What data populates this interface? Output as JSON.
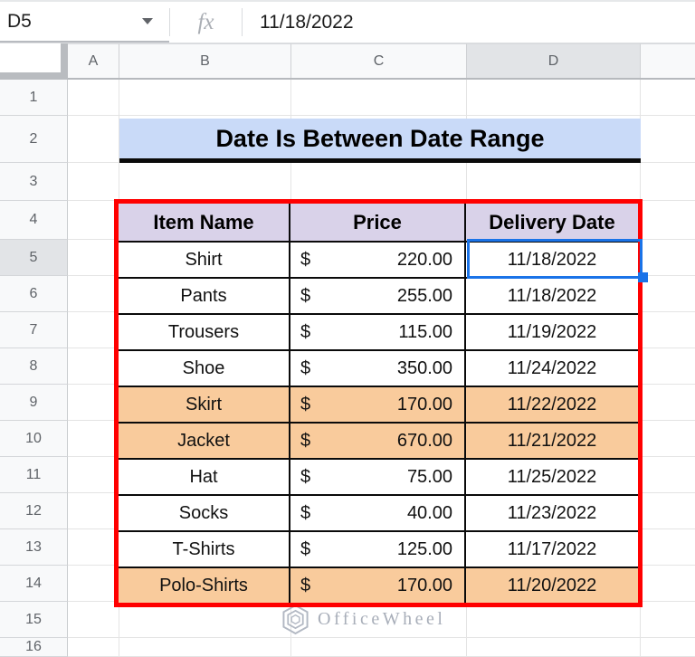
{
  "formula_bar": {
    "cell_reference": "D5",
    "fx_label": "fx",
    "formula_value": "11/18/2022"
  },
  "column_headers": [
    "A",
    "B",
    "C",
    "D",
    ""
  ],
  "active_column": "D",
  "row_headers": [
    "1",
    "2",
    "3",
    "4",
    "5",
    "6",
    "7",
    "8",
    "9",
    "10",
    "11",
    "12",
    "13",
    "14",
    "15",
    "16"
  ],
  "active_row": "5",
  "sheet_title": "Date Is Between Date Range",
  "data_table": {
    "column_headers": [
      "Item Name",
      "Price",
      "Delivery Date"
    ],
    "currency_symbol": "$",
    "rows": [
      {
        "item_name": "Shirt",
        "price": "220.00",
        "delivery_date": "11/18/2022",
        "highlighted": false
      },
      {
        "item_name": "Pants",
        "price": "255.00",
        "delivery_date": "11/18/2022",
        "highlighted": false
      },
      {
        "item_name": "Trousers",
        "price": "115.00",
        "delivery_date": "11/19/2022",
        "highlighted": false
      },
      {
        "item_name": "Shoe",
        "price": "350.00",
        "delivery_date": "11/24/2022",
        "highlighted": false
      },
      {
        "item_name": "Skirt",
        "price": "170.00",
        "delivery_date": "11/22/2022",
        "highlighted": true
      },
      {
        "item_name": "Jacket",
        "price": "670.00",
        "delivery_date": "11/21/2022",
        "highlighted": true
      },
      {
        "item_name": "Hat",
        "price": "75.00",
        "delivery_date": "11/25/2022",
        "highlighted": false
      },
      {
        "item_name": "Socks",
        "price": "40.00",
        "delivery_date": "11/23/2022",
        "highlighted": false
      },
      {
        "item_name": "T-Shirts",
        "price": "125.00",
        "delivery_date": "11/17/2022",
        "highlighted": false
      },
      {
        "item_name": "Polo-Shirts",
        "price": "170.00",
        "delivery_date": "11/20/2022",
        "highlighted": true
      }
    ],
    "selected_cell": "D5"
  },
  "watermark": {
    "brand": "OfficeWheel"
  },
  "colors": {
    "title_background": "#c9daf8",
    "table_header_background": "#d9d2e9",
    "highlight_background": "#f9cb9c",
    "table_border": "#ff0000",
    "selection_border": "#1a73e8"
  }
}
